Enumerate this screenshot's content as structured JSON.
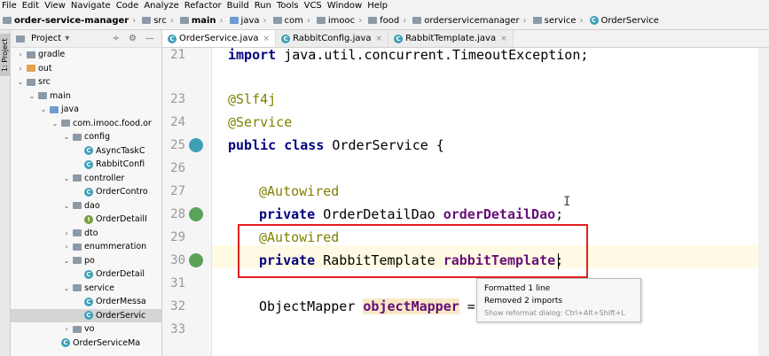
{
  "menu": [
    "File",
    "Edit",
    "View",
    "Navigate",
    "Code",
    "Analyze",
    "Refactor",
    "Build",
    "Run",
    "Tools",
    "VCS",
    "Window",
    "Help"
  ],
  "breadcrumbs": [
    {
      "label": "order-service-manager",
      "icon": "folder",
      "bold": true
    },
    {
      "label": "src",
      "icon": "folder"
    },
    {
      "label": "main",
      "icon": "folder",
      "bold": true
    },
    {
      "label": "java",
      "icon": "folder-blue"
    },
    {
      "label": "com",
      "icon": "folder"
    },
    {
      "label": "imooc",
      "icon": "folder"
    },
    {
      "label": "food",
      "icon": "folder"
    },
    {
      "label": "orderservicemanager",
      "icon": "folder"
    },
    {
      "label": "service",
      "icon": "folder"
    },
    {
      "label": "OrderService",
      "icon": "class"
    }
  ],
  "side_strip_label": "1: Project",
  "project_panel": {
    "title": "Project",
    "dropdown": "▾",
    "controls": [
      "÷",
      "⚙",
      "—"
    ]
  },
  "tree": [
    {
      "label": "gradle",
      "indent": 0,
      "arrow": "›",
      "icon": "folder"
    },
    {
      "label": "out",
      "indent": 0,
      "arrow": "›",
      "icon": "folder-orange"
    },
    {
      "label": "src",
      "indent": 0,
      "arrow": "⌄",
      "icon": "folder"
    },
    {
      "label": "main",
      "indent": 1,
      "arrow": "⌄",
      "icon": "folder"
    },
    {
      "label": "java",
      "indent": 2,
      "arrow": "⌄",
      "icon": "folder-blue"
    },
    {
      "label": "com.imooc.food.or",
      "indent": 3,
      "arrow": "⌄",
      "icon": "folder"
    },
    {
      "label": "config",
      "indent": 4,
      "arrow": "⌄",
      "icon": "folder"
    },
    {
      "label": "AsyncTaskC",
      "indent": 5,
      "arrow": "",
      "icon": "class"
    },
    {
      "label": "RabbitConfi",
      "indent": 5,
      "arrow": "",
      "icon": "class"
    },
    {
      "label": "controller",
      "indent": 4,
      "arrow": "⌄",
      "icon": "folder"
    },
    {
      "label": "OrderContro",
      "indent": 5,
      "arrow": "",
      "icon": "class"
    },
    {
      "label": "dao",
      "indent": 4,
      "arrow": "⌄",
      "icon": "folder"
    },
    {
      "label": "OrderDetailI",
      "indent": 5,
      "arrow": "",
      "icon": "interface"
    },
    {
      "label": "dto",
      "indent": 4,
      "arrow": "›",
      "icon": "folder"
    },
    {
      "label": "enummeration",
      "indent": 4,
      "arrow": "›",
      "icon": "folder"
    },
    {
      "label": "po",
      "indent": 4,
      "arrow": "⌄",
      "icon": "folder"
    },
    {
      "label": "OrderDetail",
      "indent": 5,
      "arrow": "",
      "icon": "class"
    },
    {
      "label": "service",
      "indent": 4,
      "arrow": "⌄",
      "icon": "folder"
    },
    {
      "label": "OrderMessa",
      "indent": 5,
      "arrow": "",
      "icon": "class"
    },
    {
      "label": "OrderServic",
      "indent": 5,
      "arrow": "",
      "icon": "class",
      "selected": true
    },
    {
      "label": "vo",
      "indent": 4,
      "arrow": "›",
      "icon": "folder"
    },
    {
      "label": "OrderServiceMa",
      "indent": 3,
      "arrow": "",
      "icon": "class-app"
    }
  ],
  "tabs": [
    {
      "label": "OrderService.java",
      "active": true
    },
    {
      "label": "RabbitConfig.java",
      "active": false
    },
    {
      "label": "RabbitTemplate.java",
      "active": false
    }
  ],
  "tab_close": "×",
  "line_numbers": [
    "21",
    "23",
    "24",
    "25",
    "26",
    "27",
    "28",
    "29",
    "30",
    "31",
    "32",
    "33"
  ],
  "code": {
    "l21": {
      "kw": "import",
      "rest": " java.util.concurrent.TimeoutException;"
    },
    "l23": {
      "ann": "@Slf4j"
    },
    "l24": {
      "ann": "@Service"
    },
    "l25": {
      "kw": "public class",
      "rest": " OrderService {"
    },
    "l27": {
      "ann": "@Autowired"
    },
    "l28": {
      "kw": "private",
      "type": " OrderDetailDao ",
      "field": "orderDetailDao",
      "end": ";"
    },
    "l29": {
      "ann": "@Autowired"
    },
    "l30": {
      "kw": "private",
      "type": " RabbitTemplate ",
      "field": "rabbitTemplate",
      "end": ";"
    },
    "l32": {
      "type": "ObjectMapper ",
      "field": "objectMapper",
      "end": " ="
    }
  },
  "popup": {
    "line1": "Formatted 1 line",
    "line2": "Removed 2 imports",
    "hint": "Show reformat dialog: Ctrl+Alt+Shift+L"
  },
  "colors": {
    "highlight_box": "#e02020",
    "class_icon": "#3f9fb8",
    "annotation": "#808000",
    "field": "#660e7a",
    "keyword": "#000080"
  }
}
